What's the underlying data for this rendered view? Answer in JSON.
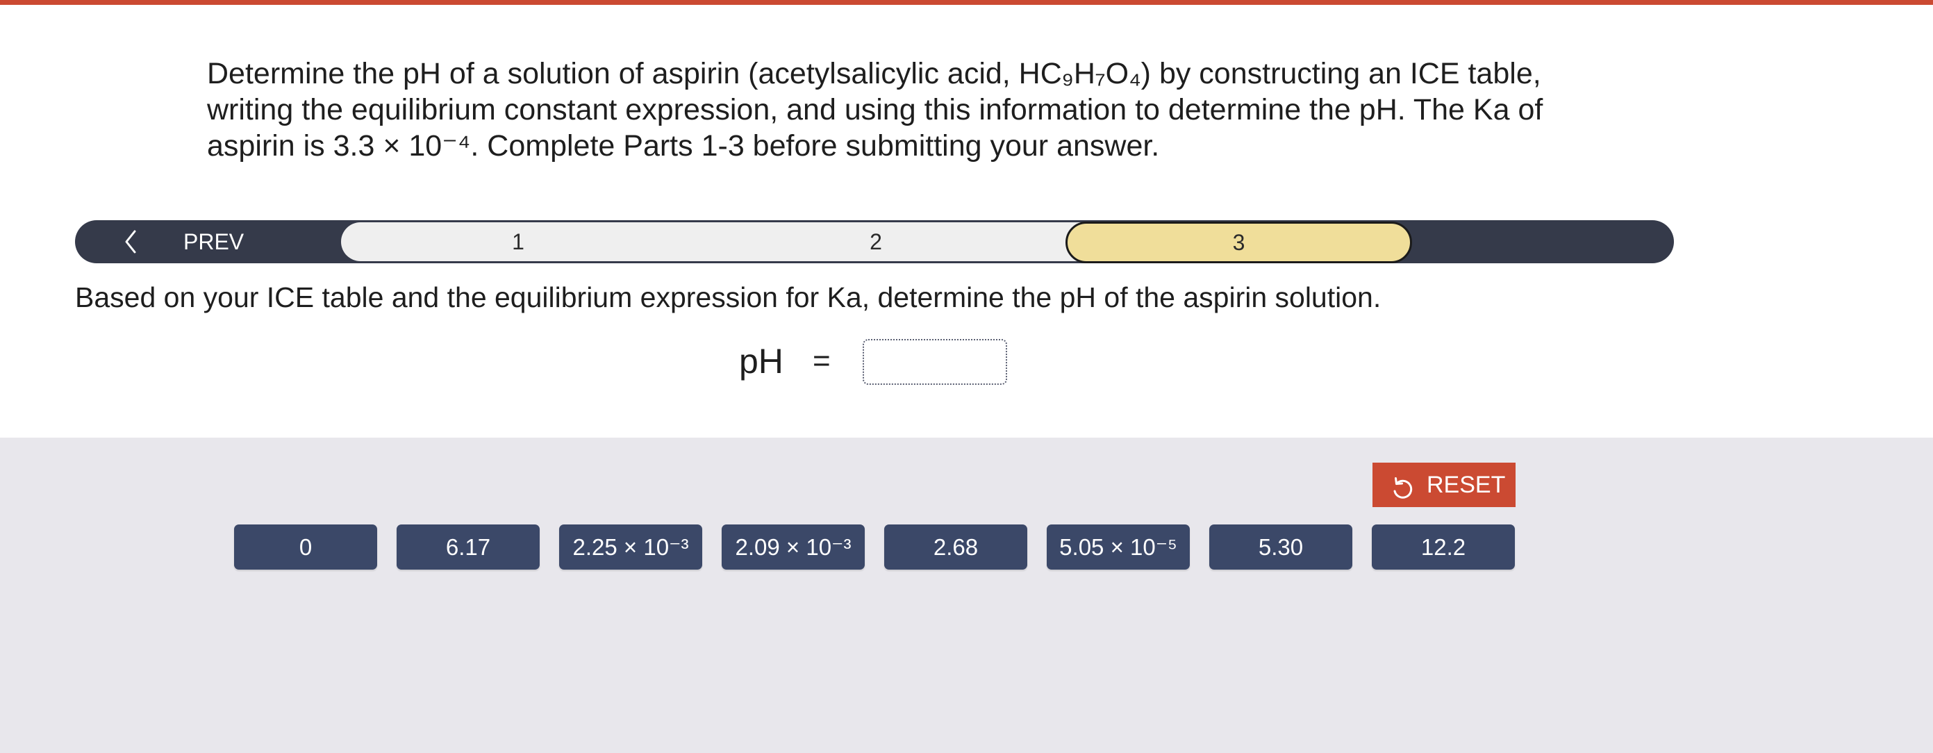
{
  "question": {
    "text": "Determine the pH of a solution of aspirin (acetylsalicylic acid, HC₉H₇O₄) by constructing an ICE table, writing the equilibrium constant expression, and using this information to determine the pH. The Ka of aspirin is 3.3 × 10⁻⁴. Complete Parts 1-3 before submitting your answer."
  },
  "nav": {
    "prev_label": "PREV",
    "steps": [
      {
        "label": "1",
        "active": false
      },
      {
        "label": "2",
        "active": false
      },
      {
        "label": "3",
        "active": true
      }
    ]
  },
  "part": {
    "prompt": "Based on your ICE table and the equilibrium expression for Ka, determine the pH of the aspirin solution.",
    "answer_label": "pH",
    "equals": "=",
    "answer_value": ""
  },
  "tray": {
    "reset_label": "RESET",
    "tiles": [
      "0",
      "6.17",
      "2.25 × 10⁻³",
      "2.09 × 10⁻³",
      "2.68",
      "5.05 × 10⁻⁵",
      "5.30",
      "12.2"
    ]
  },
  "colors": {
    "accent": "#cb4a32",
    "nav_bar": "#353a4a",
    "active_step": "#f0de9a",
    "tile": "#3b4868",
    "tray_background": "#e8e7ec"
  },
  "icons": {
    "prev": "chevron-left-icon",
    "reset": "reset-icon"
  }
}
